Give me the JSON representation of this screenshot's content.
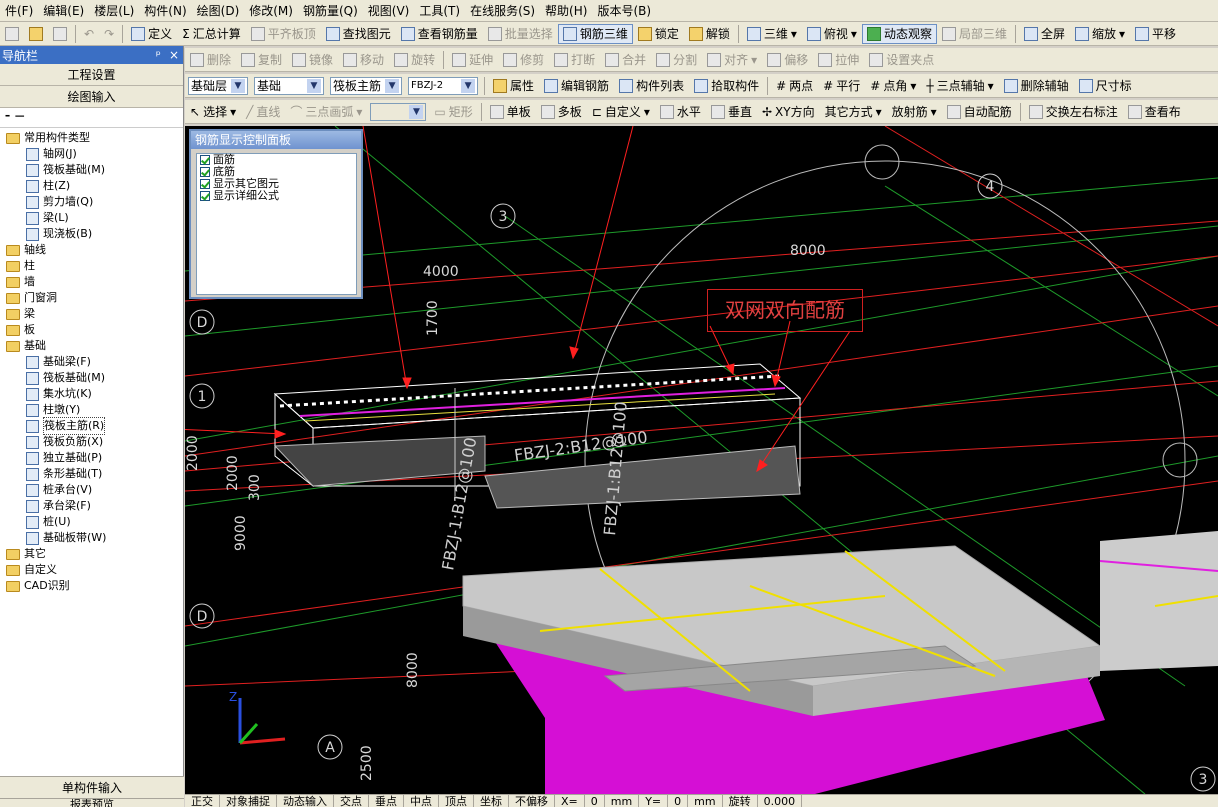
{
  "menu": [
    "件(F)",
    "编辑(E)",
    "楼层(L)",
    "构件(N)",
    "绘图(D)",
    "修改(M)",
    "钢筋量(Q)",
    "视图(V)",
    "工具(T)",
    "在线服务(S)",
    "帮助(H)",
    "版本号(B)"
  ],
  "toolbar1": {
    "define": "定义",
    "sum_calc": "汇总计算",
    "flat_slab_top": "平齐板顶",
    "find_element": "查找图元",
    "view_rebar": "查看钢筋量",
    "batch_select": "批量选择",
    "rebar_3d": "钢筋三维",
    "lock": "锁定",
    "unlock": "解锁",
    "view_3d": "三维",
    "top_view": "俯视",
    "dynamic_observe": "动态观察",
    "partial_3d": "局部三维",
    "fullscreen": "全屏",
    "zoom": "缩放",
    "pan": "平移"
  },
  "toolbar2": [
    "删除",
    "复制",
    "镜像",
    "移动",
    "旋转",
    "延伸",
    "修剪",
    "打断",
    "合并",
    "分割",
    "对齐",
    "偏移",
    "拉伸",
    "设置夹点"
  ],
  "toolbar3": {
    "layer_combo": "基础层",
    "layer_value": "基础",
    "type_combo": "筏板主筋",
    "name_combo": "FBZJ-2",
    "properties": "属性",
    "edit_rebar": "编辑钢筋",
    "element_list": "构件列表",
    "pick_element": "拾取构件",
    "two_points": "两点",
    "parallel": "平行",
    "point_angle": "点角",
    "three_point_aux": "三点辅轴",
    "delete_aux": "删除辅轴",
    "dimension": "尺寸标"
  },
  "toolbar4": [
    "选择",
    "直线",
    "三点画弧",
    "矩形",
    "单板",
    "多板",
    "自定义",
    "水平",
    "垂直",
    "XY方向",
    "其它方式",
    "放射筋",
    "自动配筋",
    "交换左右标注",
    "查看布"
  ],
  "sidebar": {
    "title": "导航栏",
    "tab1": "工程设置",
    "tab2": "绘图输入",
    "bottom1": "单构件输入",
    "bottom2": "报表预览",
    "tree": [
      {
        "label": "常用构件类型",
        "level": 1,
        "folder": true
      },
      {
        "label": "轴网(J)",
        "level": 2
      },
      {
        "label": "筏板基础(M)",
        "level": 2
      },
      {
        "label": "柱(Z)",
        "level": 2
      },
      {
        "label": "剪力墙(Q)",
        "level": 2
      },
      {
        "label": "梁(L)",
        "level": 2
      },
      {
        "label": "现浇板(B)",
        "level": 2
      },
      {
        "label": "轴线",
        "level": 1,
        "folder": true
      },
      {
        "label": "柱",
        "level": 1,
        "folder": true
      },
      {
        "label": "墙",
        "level": 1,
        "folder": true
      },
      {
        "label": "门窗洞",
        "level": 1,
        "folder": true
      },
      {
        "label": "梁",
        "level": 1,
        "folder": true
      },
      {
        "label": "板",
        "level": 1,
        "folder": true
      },
      {
        "label": "基础",
        "level": 1,
        "folder": true
      },
      {
        "label": "基础梁(F)",
        "level": 2
      },
      {
        "label": "筏板基础(M)",
        "level": 2
      },
      {
        "label": "集水坑(K)",
        "level": 2
      },
      {
        "label": "柱墩(Y)",
        "level": 2
      },
      {
        "label": "筏板主筋(R)",
        "level": 2,
        "selected": true
      },
      {
        "label": "筏板负筋(X)",
        "level": 2
      },
      {
        "label": "独立基础(P)",
        "level": 2
      },
      {
        "label": "条形基础(T)",
        "level": 2
      },
      {
        "label": "桩承台(V)",
        "level": 2
      },
      {
        "label": "承台梁(F)",
        "level": 2
      },
      {
        "label": "桩(U)",
        "level": 2
      },
      {
        "label": "基础板带(W)",
        "level": 2
      },
      {
        "label": "其它",
        "level": 1,
        "folder": true
      },
      {
        "label": "自定义",
        "level": 1,
        "folder": true
      },
      {
        "label": "CAD识别",
        "level": 1,
        "folder": true
      }
    ]
  },
  "rebar_panel": {
    "title": "钢筋显示控制面板",
    "items": [
      "面筋",
      "底筋",
      "显示其它图元",
      "显示详细公式"
    ]
  },
  "drawing": {
    "callout": "双网双向配筋",
    "axis_labels": [
      "3",
      "4",
      "D",
      "1",
      "D",
      "A",
      "3"
    ],
    "dims": [
      "8000",
      "4000",
      "1700",
      "2000",
      "2000",
      "300",
      "9000",
      "8000",
      "2500"
    ],
    "rebar_labels": [
      "FBZJ-1:B12@100",
      "FBZJ-2:B12@100",
      "FBZJ-1:B12@100"
    ]
  },
  "status": [
    "正交",
    "对象捕捉",
    "动态输入",
    "交点",
    "垂点",
    "中点",
    "顶点",
    "坐标",
    "不偏移",
    "X=",
    "0",
    "mm",
    "Y=",
    "0",
    "mm",
    "旋转",
    "0.000"
  ]
}
